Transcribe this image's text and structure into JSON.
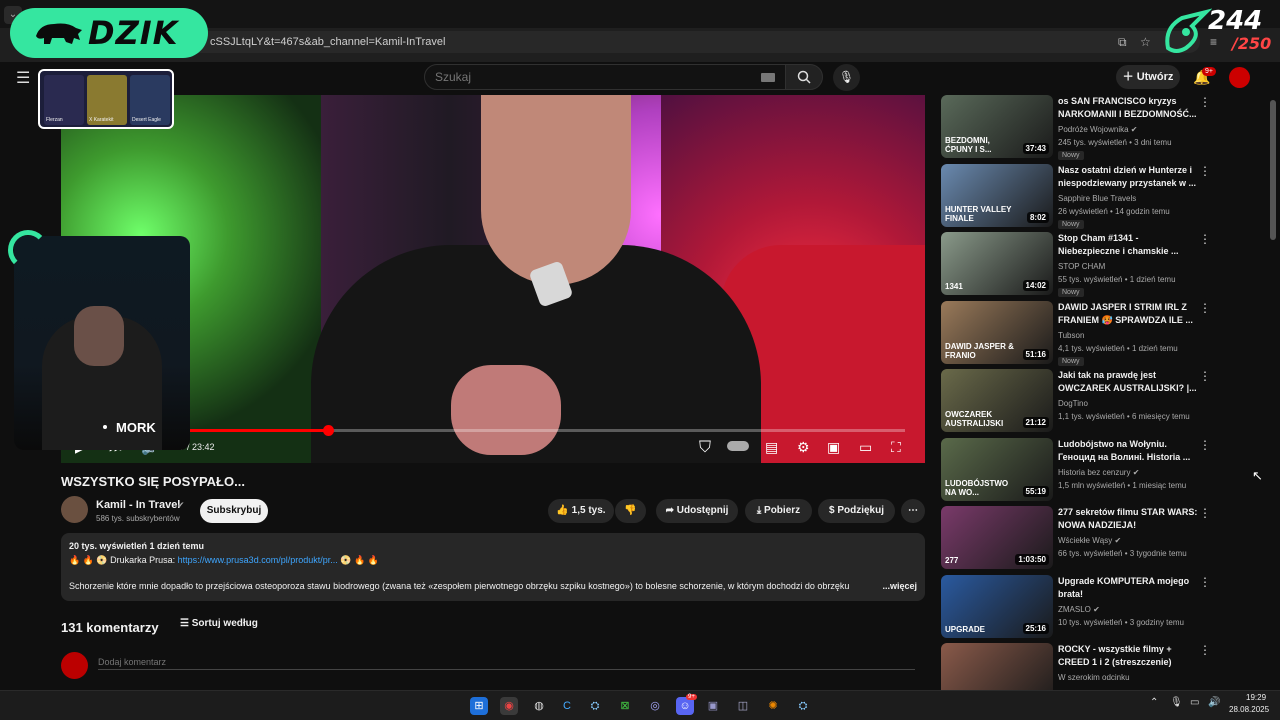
{
  "browser": {
    "url": "cSSJLtqLY&t=467s&ab_channel=Kamil-InTravel"
  },
  "overlay": {
    "brand": "DZIK",
    "counter_main": "244",
    "counter_sub": "/250",
    "webcam_name": "MORK",
    "card_labels": [
      "Flerzan",
      "X Karatekit",
      "Desert Eagle"
    ]
  },
  "header": {
    "search_placeholder": "Szukaj",
    "create_label": "Utwórz",
    "notifications_badge": "9+"
  },
  "player": {
    "time": "7:17 / 23:42",
    "progress": 0.3
  },
  "video": {
    "title": "WSZYSTKO SIĘ POSYPAŁO...",
    "channel": "Kamil - In Travel",
    "subscribers": "586 tys. subskrybentów",
    "subscribe_label": "Subskrybuj",
    "likes": "1,5 tys.",
    "share_label": "Udostępnij",
    "download_label": "Pobierz",
    "thanks_label": "Podziękuj"
  },
  "description": {
    "stats": "20 tys. wyświetleń  1 dzień temu",
    "line2_prefix": "🔥 🔥 📀 Drukarka Prusa: ",
    "line2_link": "https://www.prusa3d.com/pl/produkt/pr...",
    "line2_suffix": " 📀 🔥 🔥",
    "body": "Schorzenie które mnie dopadło to przejściowa osteoporoza stawu biodrowego (zwana też «zespołem pierwotnego obrzęku szpiku kostnego») to bolesne schorzenie, w którym dochodzi do obrzęku",
    "more": "...więcej"
  },
  "comments": {
    "count": "131 komentarzy",
    "sort_label": "Sortuj według",
    "add_placeholder": "Dodaj komentarz"
  },
  "sidebar": [
    {
      "title": "os SAN FRANCISCO kryzys NARKOMANII I BEZDOMNOŚĆ...",
      "channel": "Podróże Wojownika ✔",
      "meta": "245 tys. wyświetleń • 3 dni temu",
      "badge": "Nowy",
      "duration": "37:43",
      "thumb_text": "BEZDOMNI, ĆPUNY I S...",
      "color": "#5a6a5a"
    },
    {
      "title": "Nasz ostatni dzień w Hunterze i niespodziewany przystanek w ...",
      "channel": "Sapphire Blue Travels",
      "meta": "26 wyświetleń • 14 godzin temu",
      "badge": "Nowy",
      "duration": "8:02",
      "thumb_text": "HUNTER VALLEY FINALE",
      "color": "#6a8ab0"
    },
    {
      "title": "Stop Cham #1341 - Niebezpieczne i chamskie ...",
      "channel": "STOP CHAM",
      "meta": "55 tys. wyświetleń • 1 dzień temu",
      "badge": "Nowy",
      "duration": "14:02",
      "thumb_text": "1341",
      "color": "#8a9a8a"
    },
    {
      "title": "DAWID JASPER I STRIM IRL Z FRANIEM 🥵 SPRAWDZA ILE ...",
      "channel": "Tubson",
      "meta": "4,1 tys. wyświetleń • 1 dzień temu",
      "badge": "Nowy",
      "duration": "51:16",
      "thumb_text": "DAWID JASPER & FRANIO",
      "color": "#9a7a5a"
    },
    {
      "title": "Jaki tak na prawdę jest OWCZAREK AUSTRALIJSKI?  |...",
      "channel": "DogTino",
      "meta": "1,1 tys. wyświetleń • 6 miesięcy temu",
      "badge": "",
      "duration": "21:12",
      "thumb_text": "OWCZAREK AUSTRALIJSKI",
      "color": "#6a6a4a"
    },
    {
      "title": "Ludobójstwo na Wołyniu. Геноцид на Волині. Historia ...",
      "channel": "Historia bez cenzury ✔",
      "meta": "1,5 mln wyświetleń • 1 miesiąc temu",
      "badge": "",
      "duration": "55:19",
      "thumb_text": "LUDOBÓJSTWO NA WO...",
      "color": "#5a6a4a"
    },
    {
      "title": "277 sekretów filmu STAR WARS: NOWA NADZIEJA!",
      "channel": "Wściekłe Wąsy ✔",
      "meta": "66 tys. wyświetleń • 3 tygodnie temu",
      "badge": "",
      "duration": "1:03:50",
      "thumb_text": "277",
      "color": "#7a3a6a"
    },
    {
      "title": "Upgrade KOMPUTERA mojego brata!",
      "channel": "ZMASLO ✔",
      "meta": "10 tys. wyświetleń • 3 godziny temu",
      "badge": "",
      "duration": "25:16",
      "thumb_text": "UPGRADE",
      "color": "#2a5aa0"
    },
    {
      "title": "ROCKY - wszystkie filmy + CREED 1 i 2 (streszczenie)",
      "channel": "W szerokim odcinku",
      "meta": "",
      "badge": "",
      "duration": "",
      "thumb_text": "",
      "color": "#8a5a4a"
    }
  ],
  "taskbar": {
    "time": "19:29",
    "date": "28.08.2025",
    "discord_badge": "9+"
  }
}
